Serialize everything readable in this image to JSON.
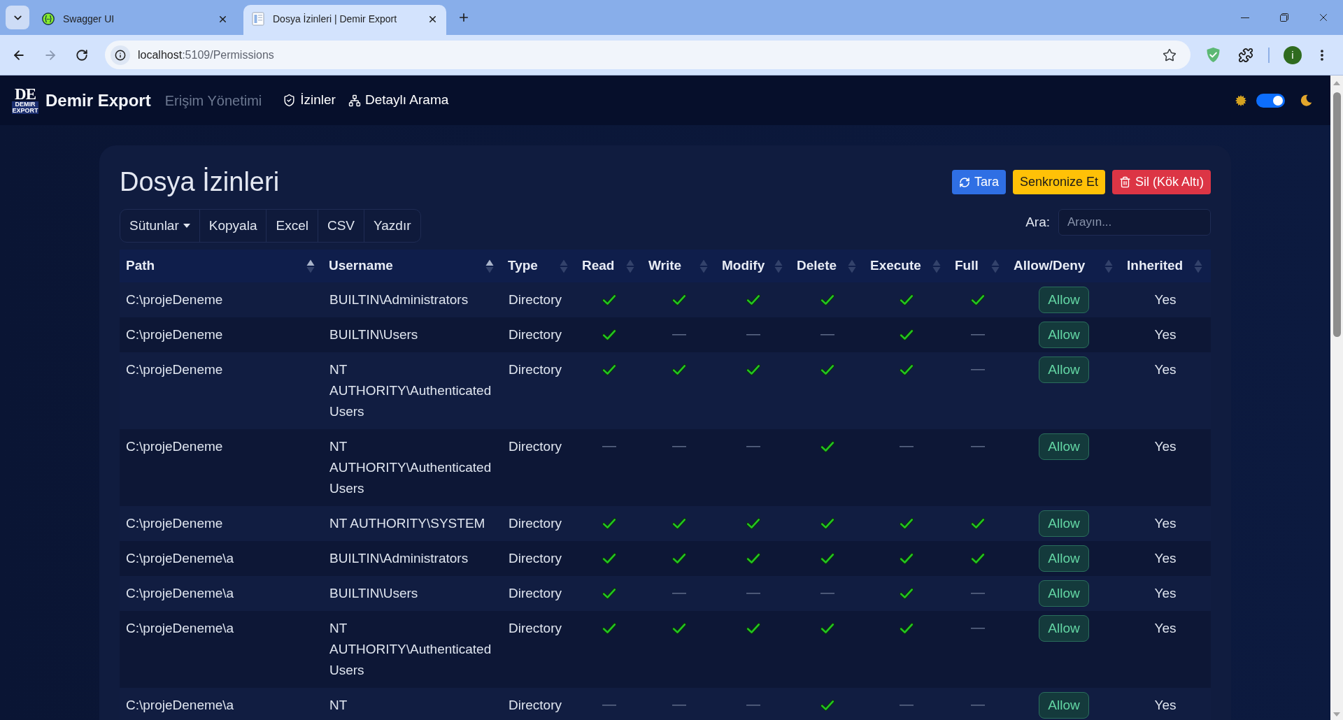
{
  "browser": {
    "tabs": [
      {
        "title": "Swagger UI",
        "kind": "swagger",
        "selected": false
      },
      {
        "title": "Dosya İzinleri | Demir Export",
        "kind": "document",
        "selected": true
      }
    ],
    "address": {
      "host": "localhost",
      "path": ":5109/Permissions"
    },
    "profile_initial": "i"
  },
  "navbar": {
    "logo": {
      "mark": "DE",
      "subtext": "DEMIR EXPORT"
    },
    "brand": "Demir Export",
    "section": "Erişim Yönetimi",
    "links": [
      {
        "label": "İzinler",
        "kind": "shield"
      },
      {
        "label": "Detaylı Arama",
        "kind": "sitemap"
      }
    ],
    "theme_toggle": {
      "on": true
    }
  },
  "card": {
    "title": "Dosya İzinleri",
    "actions": [
      {
        "label": "Tara",
        "kind": "scan"
      },
      {
        "label": "Senkronize Et",
        "kind": "sync"
      },
      {
        "label": "Sil (Kök Altı)",
        "kind": "delete"
      }
    ],
    "toolbar": [
      {
        "label": "Sütunlar",
        "kind": "dropdown"
      },
      {
        "label": "Kopyala",
        "kind": "plain"
      },
      {
        "label": "Excel",
        "kind": "plain"
      },
      {
        "label": "CSV",
        "kind": "plain"
      },
      {
        "label": "Yazdır",
        "kind": "plain"
      }
    ],
    "search": {
      "label": "Ara:",
      "placeholder": "Arayın..."
    }
  },
  "table": {
    "columns": [
      {
        "label": "Path",
        "sorted": true
      },
      {
        "label": "Username",
        "sorted": true
      },
      {
        "label": "Type",
        "sorted": false
      },
      {
        "label": "Read",
        "sorted": false
      },
      {
        "label": "Write",
        "sorted": false
      },
      {
        "label": "Modify",
        "sorted": false
      },
      {
        "label": "Delete",
        "sorted": false
      },
      {
        "label": "Execute",
        "sorted": false
      },
      {
        "label": "Full",
        "sorted": false
      },
      {
        "label": "Allow/Deny",
        "sorted": false
      },
      {
        "label": "Inherited",
        "sorted": false
      }
    ],
    "rows": [
      {
        "path": "C:\\projeDeneme",
        "username": "BUILTIN\\Administrators",
        "type": "Directory",
        "perms": [
          true,
          true,
          true,
          true,
          true,
          true
        ],
        "access": "Allow",
        "inherited": "Yes"
      },
      {
        "path": "C:\\projeDeneme",
        "username": "BUILTIN\\Users",
        "type": "Directory",
        "perms": [
          true,
          false,
          false,
          false,
          true,
          false
        ],
        "access": "Allow",
        "inherited": "Yes"
      },
      {
        "path": "C:\\projeDeneme",
        "username": "NT AUTHORITY\\Authenticated Users",
        "type": "Directory",
        "perms": [
          true,
          true,
          true,
          true,
          true,
          false
        ],
        "access": "Allow",
        "inherited": "Yes"
      },
      {
        "path": "C:\\projeDeneme",
        "username": "NT AUTHORITY\\Authenticated Users",
        "type": "Directory",
        "perms": [
          false,
          false,
          false,
          true,
          false,
          false
        ],
        "access": "Allow",
        "inherited": "Yes"
      },
      {
        "path": "C:\\projeDeneme",
        "username": "NT AUTHORITY\\SYSTEM",
        "type": "Directory",
        "perms": [
          true,
          true,
          true,
          true,
          true,
          true
        ],
        "access": "Allow",
        "inherited": "Yes"
      },
      {
        "path": "C:\\projeDeneme\\a",
        "username": "BUILTIN\\Administrators",
        "type": "Directory",
        "perms": [
          true,
          true,
          true,
          true,
          true,
          true
        ],
        "access": "Allow",
        "inherited": "Yes"
      },
      {
        "path": "C:\\projeDeneme\\a",
        "username": "BUILTIN\\Users",
        "type": "Directory",
        "perms": [
          true,
          false,
          false,
          false,
          true,
          false
        ],
        "access": "Allow",
        "inherited": "Yes"
      },
      {
        "path": "C:\\projeDeneme\\a",
        "username": "NT AUTHORITY\\Authenticated Users",
        "type": "Directory",
        "perms": [
          true,
          true,
          true,
          true,
          true,
          false
        ],
        "access": "Allow",
        "inherited": "Yes"
      },
      {
        "path": "C:\\projeDeneme\\a",
        "username": "NT",
        "type": "Directory",
        "perms": [
          false,
          false,
          false,
          true,
          false,
          false
        ],
        "access": "Allow",
        "inherited": "Yes"
      }
    ]
  }
}
